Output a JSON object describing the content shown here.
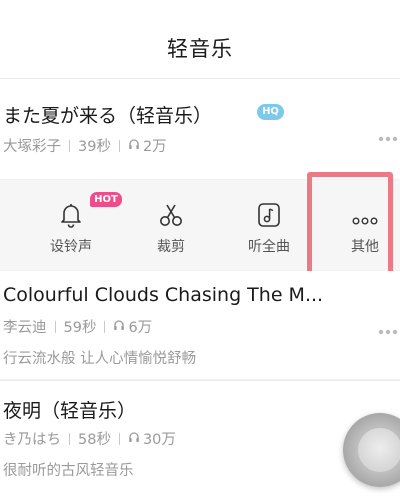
{
  "header": {
    "title": "轻音乐"
  },
  "songs": [
    {
      "title": "また夏が来る（轻音乐）",
      "artist": "大塚彩子",
      "duration": "39秒",
      "plays": "2万",
      "badge": "HQ"
    },
    {
      "title": "Colourful Clouds Chasing The M...",
      "artist": "李云迪",
      "duration": "59秒",
      "plays": "6万",
      "desc": "行云流水般 让人心情愉悦舒畅"
    },
    {
      "title": "夜明（轻音乐）",
      "artist": "き乃はち",
      "duration": "58秒",
      "plays": "30万",
      "desc": "很耐听的古风轻音乐"
    }
  ],
  "actions": [
    {
      "label": "设铃声",
      "icon": "bell-icon",
      "badge": "HOT"
    },
    {
      "label": "裁剪",
      "icon": "scissors-icon"
    },
    {
      "label": "听全曲",
      "icon": "music-note-icon"
    },
    {
      "label": "其他",
      "icon": "more-icon"
    }
  ],
  "colors": {
    "hot_badge": "#ee4d8a",
    "hq_badge": "#7cc9ec",
    "highlight": "#ec7a85"
  }
}
